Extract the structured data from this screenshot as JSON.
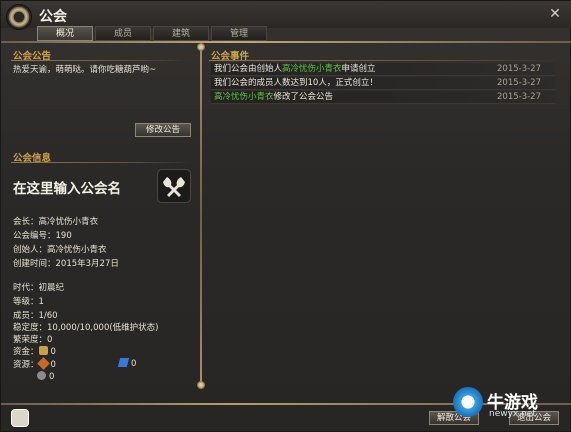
{
  "window": {
    "title": "公会"
  },
  "tabs": [
    {
      "label": "概况"
    },
    {
      "label": "成员"
    },
    {
      "label": "建筑"
    },
    {
      "label": "管理"
    }
  ],
  "notice": {
    "title": "公会公告",
    "text": "热爱天谕，萌萌哒。请你吃糖葫芦哟~",
    "edit_button": "修改公告"
  },
  "info": {
    "title": "公会信息",
    "name_placeholder": "在这里输入公会名",
    "leader": "会长：高冷忧伤小青衣",
    "id": "公会编号：190",
    "founder": "创始人：高冷忧伤小青衣",
    "created": "创建时间：2015年3月27日",
    "era": "时代：初晨纪",
    "level": "等级：1",
    "members": "成员：1/60",
    "stability": "稳定度：10,000/10,000(低维护状态)",
    "prosperity": "繁荣度：0",
    "funds_label": "资金：",
    "funds_value": "0",
    "resources_label": "资源：",
    "res1": "0",
    "res2": "0",
    "res3": "0"
  },
  "events": {
    "title": "公会事件",
    "rows": [
      {
        "prefix": "我们公会由创始人",
        "name": "高冷忧伤小青衣",
        "suffix": "申请创立",
        "date": "2015-3-27"
      },
      {
        "prefix": "我们公会的成员人数达到10人，正式创立！",
        "name": "",
        "suffix": "",
        "date": "2015-3-27"
      },
      {
        "prefix": "",
        "name": "高冷忧伤小青衣",
        "suffix": "修改了公会公告",
        "date": "2015-3-27"
      }
    ]
  },
  "bottom": {
    "dissolve_button": "解散公会",
    "leave_button": "退出公会"
  },
  "watermark": {
    "text": "牛游戏",
    "url": "newyx.net"
  },
  "colors": {
    "accent": "#d1a24a",
    "highlight_name": "#5ec447"
  }
}
